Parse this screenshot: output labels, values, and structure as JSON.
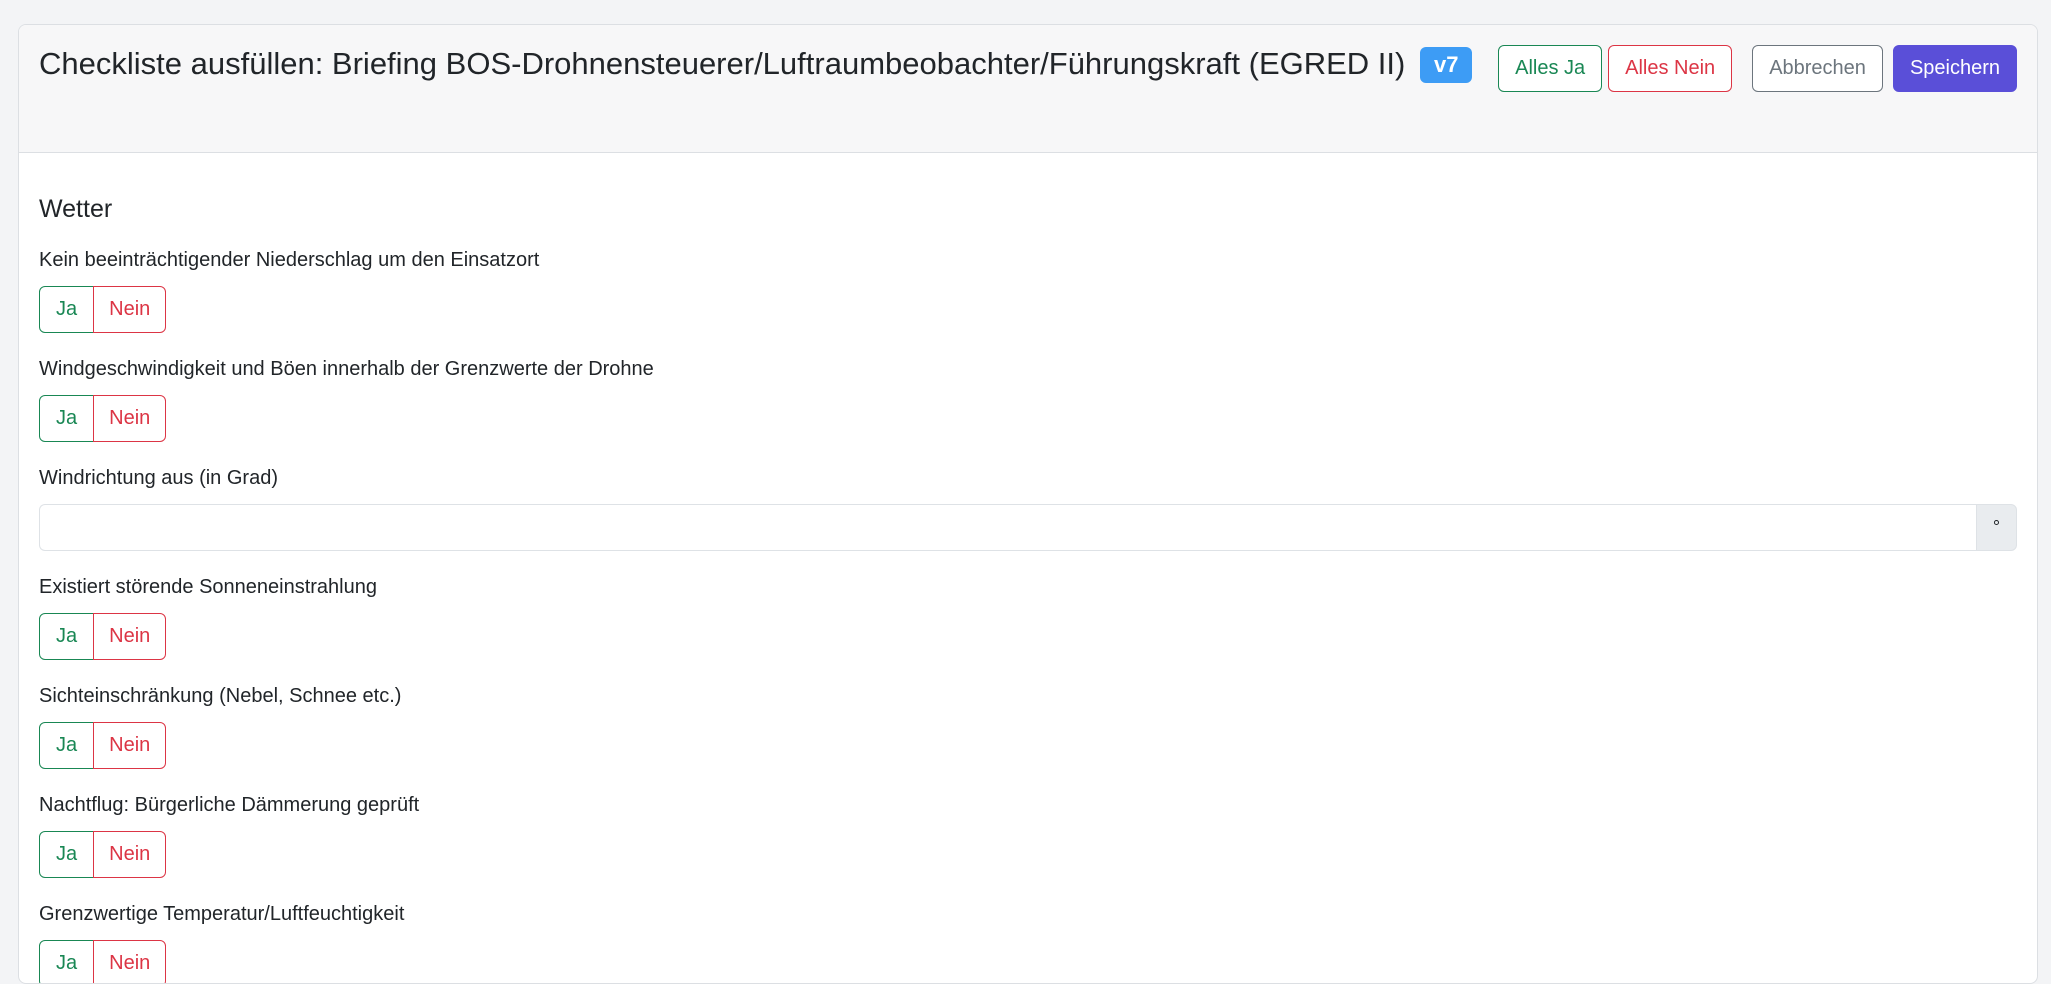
{
  "header": {
    "title": "Checkliste ausfüllen: Briefing BOS-Drohnensteuerer/Luftraumbeobachter/Führungskraft (EGRED II)",
    "version_badge": "v7",
    "buttons": {
      "all_yes": "Alles Ja",
      "all_no": "Alles Nein",
      "cancel": "Abbrechen",
      "save": "Speichern"
    }
  },
  "section": {
    "title": "Wetter",
    "yes_label": "Ja",
    "no_label": "Nein",
    "items": [
      {
        "label": "Kein beeinträchtigender Niederschlag um den Einsatzort"
      },
      {
        "label": "Windgeschwindigkeit und Böen innerhalb der Grenzwerte der Drohne"
      },
      {
        "label": "Windrichtung aus (in Grad)",
        "input_value": "",
        "unit": "°"
      },
      {
        "label": "Existiert störende Sonneneinstrahlung"
      },
      {
        "label": "Sichteinschränkung (Nebel, Schnee etc.)"
      },
      {
        "label": "Nachtflug: Bürgerliche Dämmerung geprüft"
      },
      {
        "label": "Grenzwertige Temperatur/Luftfeuchtigkeit"
      }
    ]
  },
  "colors": {
    "success": "#198754",
    "danger": "#dc3545",
    "primary": "#5a4fd8",
    "badge": "#3d9cf5"
  }
}
